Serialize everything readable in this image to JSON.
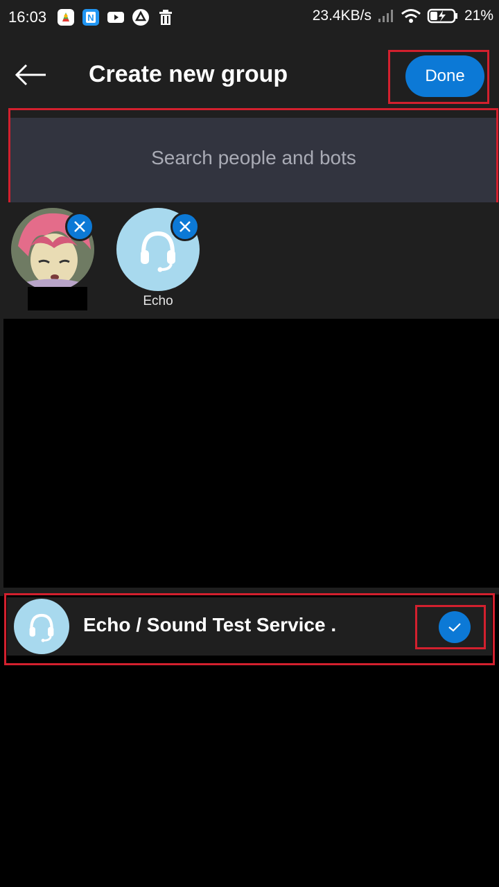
{
  "status_bar": {
    "time": "16:03",
    "network_speed": "23.4KB/s",
    "battery": "21%",
    "notification_icons": [
      "maps-icon",
      "n-app-icon",
      "youtube-icon",
      "drive-icon",
      "trash-icon"
    ]
  },
  "header": {
    "title": "Create new group",
    "done_label": "Done"
  },
  "search": {
    "placeholder": "Search people and bots"
  },
  "selected": [
    {
      "name": "",
      "avatar": "anime-avatar"
    },
    {
      "name": "Echo",
      "avatar": "headset-icon"
    }
  ],
  "list": {
    "items": [
      {
        "name": "Echo / Sound Test Service .",
        "selected": true
      }
    ]
  },
  "colors": {
    "accent": "#0c79d6",
    "surface": "#1f1f1f",
    "search_bg": "#32343f",
    "highlight": "#d3202e",
    "echo_avatar": "#a8d9ee"
  }
}
